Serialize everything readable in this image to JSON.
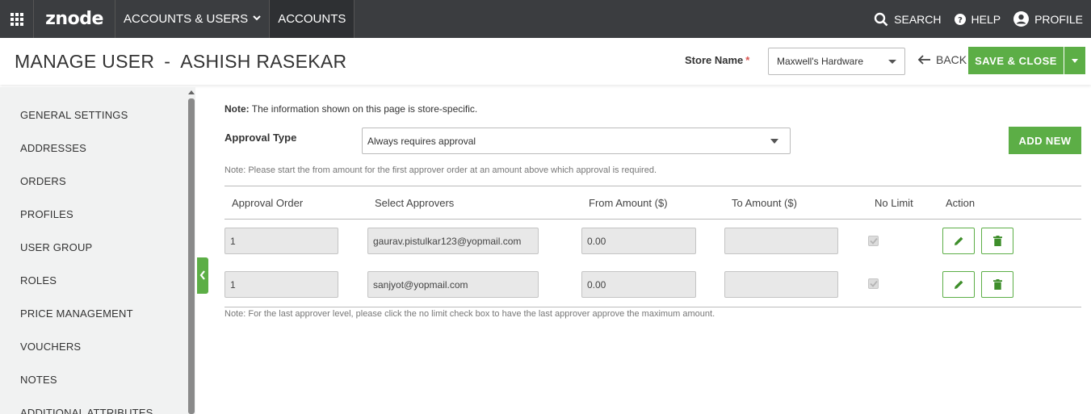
{
  "topnav": {
    "apps_icon": "grid-icon",
    "logo": "znode",
    "menu": [
      {
        "label": "ACCOUNTS & USERS",
        "has_dropdown": true
      },
      {
        "label": "ACCOUNTS",
        "active": true
      }
    ],
    "right": [
      {
        "label": "SEARCH",
        "icon": "search-icon"
      },
      {
        "label": "HELP",
        "icon": "help-icon"
      },
      {
        "label": "PROFILE",
        "icon": "user-icon"
      }
    ]
  },
  "header": {
    "title_prefix": "MANAGE USER",
    "title_sep": "-",
    "title_name": "ASHISH RASEKAR",
    "store_label": "Store Name",
    "store_required": "*",
    "store_value": "Maxwell's Hardware",
    "back_label": "BACK",
    "save_close_label": "SAVE & CLOSE"
  },
  "sidebar": {
    "items": [
      "GENERAL SETTINGS",
      "ADDRESSES",
      "ORDERS",
      "PROFILES",
      "USER GROUP",
      "ROLES",
      "PRICE MANAGEMENT",
      "VOUCHERS",
      "NOTES",
      "ADDITIONAL ATTRIBUTES"
    ]
  },
  "main": {
    "note_prefix": "Note:",
    "note_text": "The information shown on this page is store-specific.",
    "approval_type_label": "Approval Type",
    "approval_type_value": "Always requires approval",
    "add_new_label": "ADD NEW",
    "note_start": "Note: Please start the from amount for the first approver order at an amount above which approval is required.",
    "table": {
      "headers": [
        "Approval Order",
        "Select Approvers",
        "From Amount ($)",
        "To Amount ($)",
        "No Limit",
        "Action"
      ],
      "rows": [
        {
          "order": "1",
          "approver": "gaurav.pistulkar123@yopmail.com",
          "from": "0.00",
          "to": "",
          "no_limit": true
        },
        {
          "order": "1",
          "approver": "sanjyot@yopmail.com",
          "from": "0.00",
          "to": "",
          "no_limit": true
        }
      ]
    },
    "note_end": "Note: For the last approver level, please click the no limit check box to have the last approver approve the maximum amount."
  },
  "colors": {
    "nav_bg": "#3b3d40",
    "accent_green": "#5cae46",
    "sidebar_bg": "#f1f2f2"
  }
}
